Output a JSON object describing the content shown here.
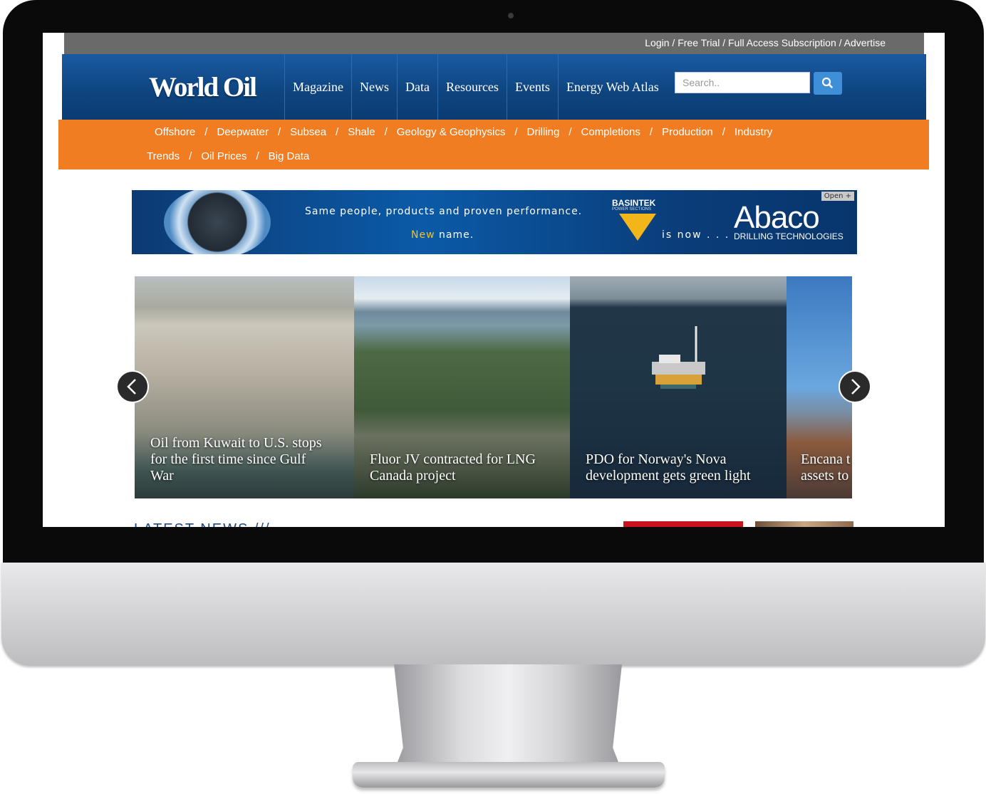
{
  "topbar": {
    "links": [
      "Login",
      "Free Trial",
      "Full Access Subscription",
      "Advertise"
    ],
    "separator": " / "
  },
  "header": {
    "logo": "World Oil",
    "nav": [
      "Magazine",
      "News",
      "Data",
      "Resources",
      "Events",
      "Energy Web Atlas"
    ],
    "search_placeholder": "Search..",
    "search_icon": "search-icon"
  },
  "subnav": {
    "row1": [
      "Offshore",
      "Deepwater",
      "Subsea",
      "Shale",
      "Geology & Geophysics",
      "Drilling",
      "Completions",
      "Production",
      "Industry"
    ],
    "row2": [
      "Trends",
      "Oil Prices",
      "Big Data"
    ],
    "separator": "/"
  },
  "ad": {
    "line1": "Same people, products and proven performance.",
    "new_word": "New",
    "line2_rest": " name.",
    "brand_old": "BASINTEK",
    "brand_old_sub": "POWER SECTIONS",
    "is_now": "is now . . .",
    "brand_new": "Abaco",
    "brand_new_sub": "DRILLING TECHNOLOGIES",
    "open_label": "Open +"
  },
  "carousel": {
    "slides": [
      {
        "caption_lines": [
          "Oil from Kuwait to U.S. stops",
          "for the first time since Gulf",
          "War"
        ]
      },
      {
        "caption_lines": [
          "Fluor JV contracted for LNG",
          "Canada project"
        ]
      },
      {
        "caption_lines": [
          "PDO for Norway's Nova",
          "development gets green light"
        ]
      },
      {
        "caption_lines": [
          "Encana t",
          "assets to"
        ]
      }
    ],
    "prev_icon": "chevron-left-icon",
    "next_icon": "chevron-right-icon"
  },
  "latest_news": "LATEST NEWS ///",
  "colors": {
    "header_blue": "#0e447f",
    "subnav_orange": "#f07d21",
    "topbar_gray": "#6a6a6a",
    "search_button": "#3f8ed8"
  }
}
